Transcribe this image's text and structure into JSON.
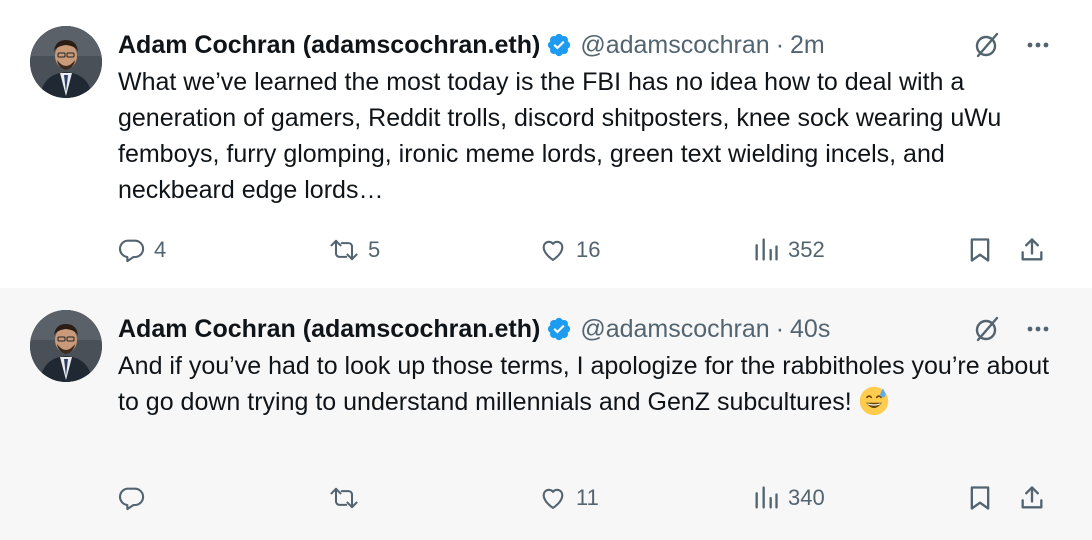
{
  "tweets": [
    {
      "name": "Adam Cochran (adamscochran.eth)",
      "handle": "@adamscochran",
      "separator": "·",
      "time": "2m",
      "text": "What we’ve learned the most today is the FBI has no idea how to deal with a generation of gamers, Reddit trolls, discord shitposters, knee sock wearing uWu femboys, furry glomping, ironic meme lords, green text wielding incels, and neckbeard edge lords…",
      "replies": "4",
      "retweets": "5",
      "likes": "16",
      "views": "352"
    },
    {
      "name": "Adam Cochran (adamscochran.eth)",
      "handle": "@adamscochran",
      "separator": "·",
      "time": "40s",
      "text": "And if you’ve had to look up those terms, I apologize for the rabbitholes you’re about to go down trying to understand millennials and GenZ subcultures!",
      "emoji": "grinning-sweat-emoji",
      "replies": "",
      "retweets": "",
      "likes": "11",
      "views": "340"
    }
  ],
  "colors": {
    "text": "#0f1419",
    "secondary": "#536471",
    "verified": "#1d9bf0",
    "thread_line": "#cfd9de",
    "reply_background": "#f7f7f7"
  },
  "icons": [
    "verified-badge-icon",
    "grok-icon",
    "more-icon",
    "reply-icon",
    "retweet-icon",
    "like-icon",
    "views-icon",
    "bookmark-icon",
    "share-icon"
  ]
}
